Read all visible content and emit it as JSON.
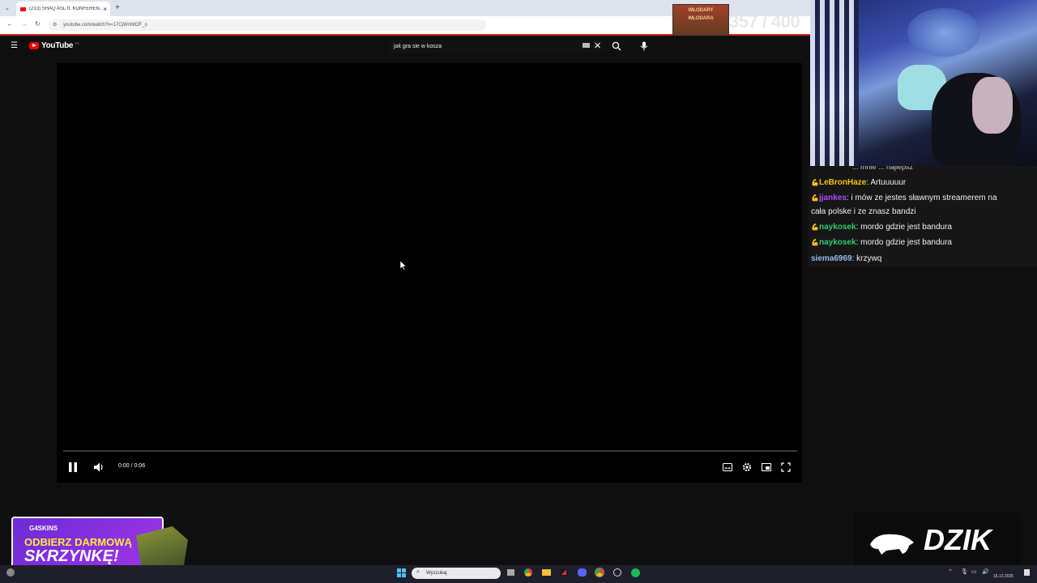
{
  "browser": {
    "tab_title": "(213) SHAQ ASL ft. KONFEREN...",
    "url": "youtube.com/watch?v=17CjWnNtOF_o",
    "new_tab_symbol": "+",
    "tab_close_symbol": "×"
  },
  "youtube": {
    "logo_text": "YouTube",
    "logo_region": "PL",
    "search_query": "jak gra sie w kosza"
  },
  "player": {
    "timecode": "0:00 / 0:06",
    "progress_fraction": 0.0
  },
  "overlay": {
    "counter_image_text": "WŁODARY WŁODARA",
    "counter": "357 / 400"
  },
  "chat": {
    "partial_line": "... mnie ... najlepsz",
    "messages": [
      {
        "user": "LeBronHaze",
        "text": ": Artuuuuur",
        "color": "#f5c400",
        "icon": "muscle"
      },
      {
        "user": "jjankes",
        "text": ": i mów ze jestes sławnym streamerem na cała polske i ze znasz bandzi",
        "color": "#b14bff",
        "icon": "muscle"
      },
      {
        "user": "naykosek",
        "text": ": mordo gdzie jest bandura",
        "color": "#2ecc71",
        "icon": "muscle"
      },
      {
        "user": "naykosek",
        "text": ": mordo gdzie jest bandura",
        "color": "#2ecc71",
        "icon": "muscle"
      },
      {
        "user": "siema6969",
        "text": ": krzywq",
        "color": "#9ab8e8",
        "icon": ""
      }
    ]
  },
  "promo": {
    "brand": "G4SKINS",
    "line1": "ODBIERZ DARMOWĄ",
    "line2": "SKRZYNKĘ!"
  },
  "sponsor": {
    "logo_text": "DZIK"
  },
  "taskbar": {
    "search_placeholder": "Wyszukaj",
    "date": "16.12.2025"
  }
}
